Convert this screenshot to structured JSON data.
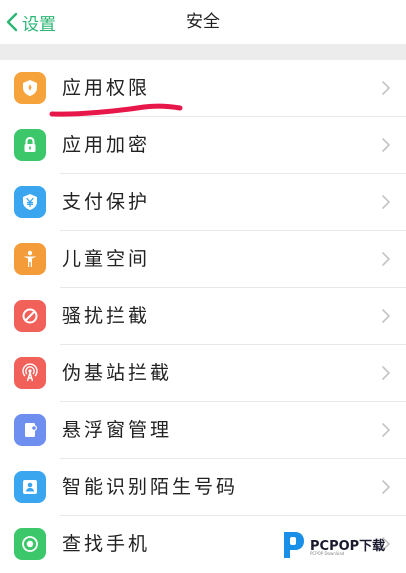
{
  "navbar": {
    "back_label": "设置",
    "title": "安全"
  },
  "items": [
    {
      "label": "应用权限",
      "icon": "shield-lock-icon",
      "color": "#f7a33c"
    },
    {
      "label": "应用加密",
      "icon": "padlock-icon",
      "color": "#3cc76a"
    },
    {
      "label": "支付保护",
      "icon": "yen-shield-icon",
      "color": "#3aa6ef"
    },
    {
      "label": "儿童空间",
      "icon": "child-icon",
      "color": "#f59c3a"
    },
    {
      "label": "骚扰拦截",
      "icon": "block-icon",
      "color": "#f2605a"
    },
    {
      "label": "伪基站拦截",
      "icon": "signal-tower-icon",
      "color": "#f2605a"
    },
    {
      "label": "悬浮窗管理",
      "icon": "floating-window-icon",
      "color": "#6f8ff0"
    },
    {
      "label": "智能识别陌生号码",
      "icon": "contact-card-icon",
      "color": "#3aa6ef"
    },
    {
      "label": "查找手机",
      "icon": "locate-icon",
      "color": "#3cc76a"
    }
  ],
  "colors": {
    "accent": "#2bb673",
    "annotation": "#e8174a"
  },
  "watermark": {
    "text": "PCPOP下载",
    "subtext": "PCPOP Download"
  }
}
